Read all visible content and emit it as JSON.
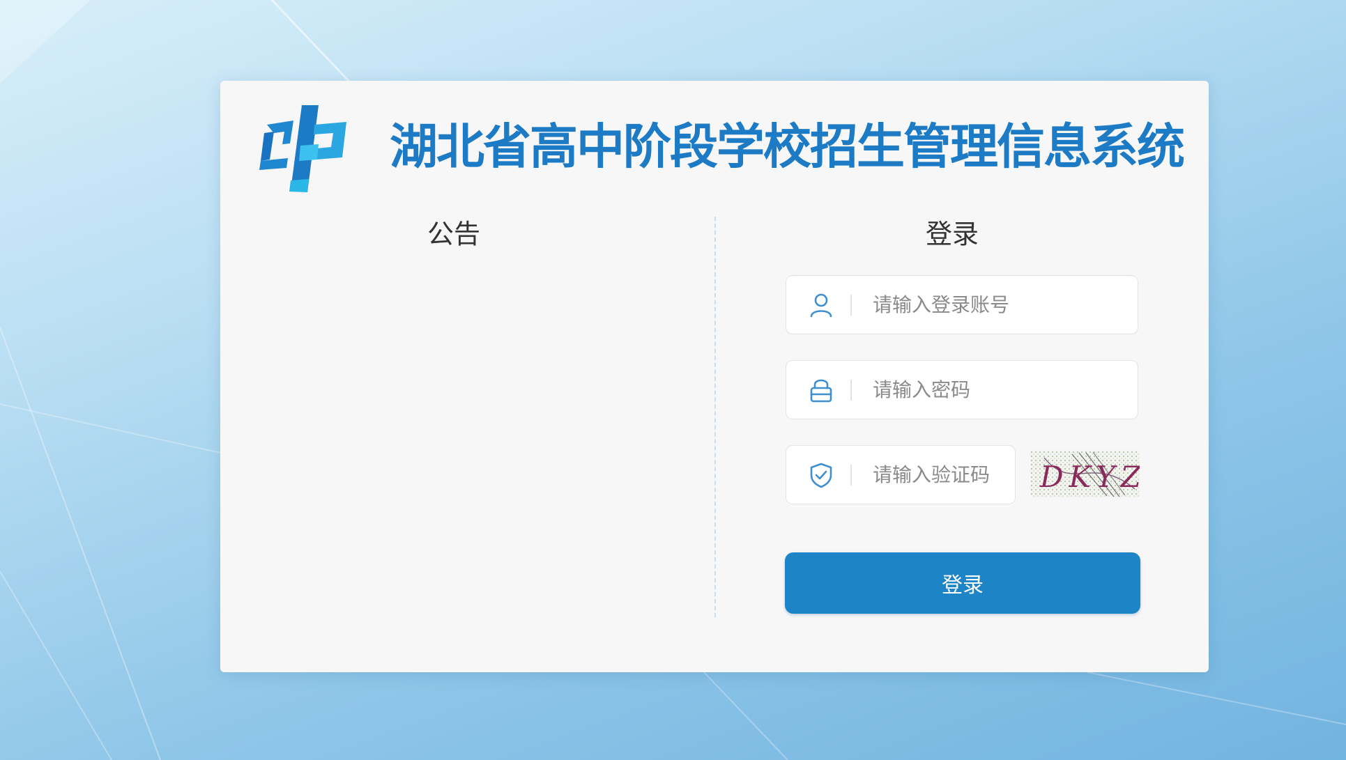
{
  "header": {
    "title": "湖北省高中阶段学校招生管理信息系统",
    "logo_icon": "zk-logo-icon"
  },
  "notice": {
    "title": "公告",
    "items": []
  },
  "login": {
    "title": "登录",
    "username": {
      "icon": "user-icon",
      "value": "",
      "placeholder": "请输入登录账号"
    },
    "password": {
      "icon": "lock-icon",
      "value": "",
      "placeholder": "请输入密码"
    },
    "captcha": {
      "icon": "shield-check-icon",
      "value": "",
      "placeholder": "请输入验证码",
      "image_text": "DKYZ"
    },
    "submit_label": "登录"
  },
  "colors": {
    "brand_blue": "#1d7bc6",
    "button_blue": "#1e84c8",
    "card_background": "#f7f7f7",
    "icon_blue": "#3d8fd0"
  }
}
